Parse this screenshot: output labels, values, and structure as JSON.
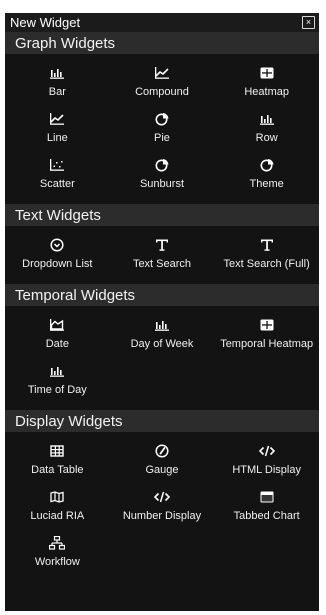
{
  "window": {
    "title": "New Widget",
    "close_glyph": "×"
  },
  "sections": {
    "graph": {
      "title": "Graph Widgets",
      "items": [
        {
          "label": "Bar",
          "icon": "bar-chart-icon"
        },
        {
          "label": "Compound",
          "icon": "line-chart-icon"
        },
        {
          "label": "Heatmap",
          "icon": "heatmap-grid-icon"
        },
        {
          "label": "Line",
          "icon": "line-chart-icon"
        },
        {
          "label": "Pie",
          "icon": "pie-chart-icon"
        },
        {
          "label": "Row",
          "icon": "bar-chart-icon"
        },
        {
          "label": "Scatter",
          "icon": "scatter-plot-icon"
        },
        {
          "label": "Sunburst",
          "icon": "pie-chart-icon"
        },
        {
          "label": "Theme",
          "icon": "pie-chart-icon"
        }
      ]
    },
    "text": {
      "title": "Text Widgets",
      "items": [
        {
          "label": "Dropdown List",
          "icon": "chevron-circle-icon"
        },
        {
          "label": "Text Search",
          "icon": "text-t-icon"
        },
        {
          "label": "Text Search (Full)",
          "icon": "text-t-icon"
        }
      ]
    },
    "temporal": {
      "title": "Temporal Widgets",
      "items": [
        {
          "label": "Date",
          "icon": "area-chart-icon"
        },
        {
          "label": "Day of Week",
          "icon": "bar-chart-icon"
        },
        {
          "label": "Temporal Heatmap",
          "icon": "heatmap-grid-icon"
        },
        {
          "label": "Time of Day",
          "icon": "bar-chart-icon"
        }
      ]
    },
    "display": {
      "title": "Display Widgets",
      "items": [
        {
          "label": "Data Table",
          "icon": "table-icon"
        },
        {
          "label": "Gauge",
          "icon": "gauge-icon"
        },
        {
          "label": "HTML Display",
          "icon": "code-icon"
        },
        {
          "label": "Luciad RIA",
          "icon": "map-icon"
        },
        {
          "label": "Number Display",
          "icon": "code-icon"
        },
        {
          "label": "Tabbed Chart",
          "icon": "tabbed-window-icon"
        },
        {
          "label": "Workflow",
          "icon": "workflow-icon"
        }
      ]
    }
  }
}
